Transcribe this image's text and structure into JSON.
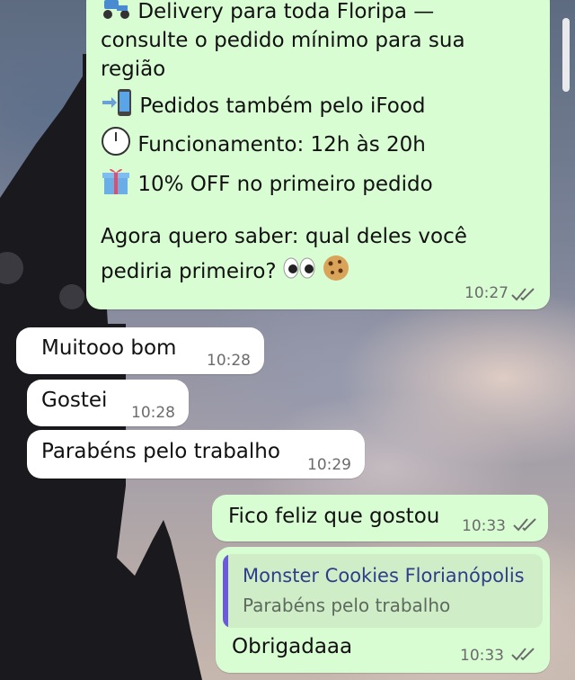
{
  "chat": {
    "long_message": {
      "line_delivery_1": "Delivery para toda Floripa —",
      "line_delivery_2": "consulte o pedido mínimo para sua",
      "line_delivery_3": "região",
      "line_ifood": "Pedidos também pelo iFood",
      "line_hours": "Funcionamento: 12h às 20h",
      "line_discount": "10% OFF no primeiro pedido",
      "line_question_1": "Agora quero saber: qual deles você",
      "line_question_2": "pediria primeiro?",
      "time": "10:27",
      "icons": [
        "scooter-icon",
        "phone-arrow-icon",
        "clock-icon",
        "gift-icon",
        "eyes-icon",
        "cookie-icon"
      ]
    },
    "incoming": [
      {
        "text": "Muitooo bom",
        "time": "10:28"
      },
      {
        "text": "Gostei",
        "time": "10:28"
      },
      {
        "text": "Parabéns pelo trabalho",
        "time": "10:29"
      }
    ],
    "outgoing_1": {
      "text": "Fico feliz que gostou",
      "time": "10:33"
    },
    "outgoing_2": {
      "quote_author": "Monster Cookies Florianópolis",
      "quote_text": "Parabéns pelo trabalho",
      "text": "Obrigadaaa",
      "time": "10:33"
    }
  },
  "colors": {
    "outgoing_bubble": "#d9fdd3",
    "incoming_bubble": "#ffffff",
    "quote_accent": "#6b5bd6",
    "quote_author": "#2f3d8a",
    "read_tick": "#6b6b6b"
  }
}
